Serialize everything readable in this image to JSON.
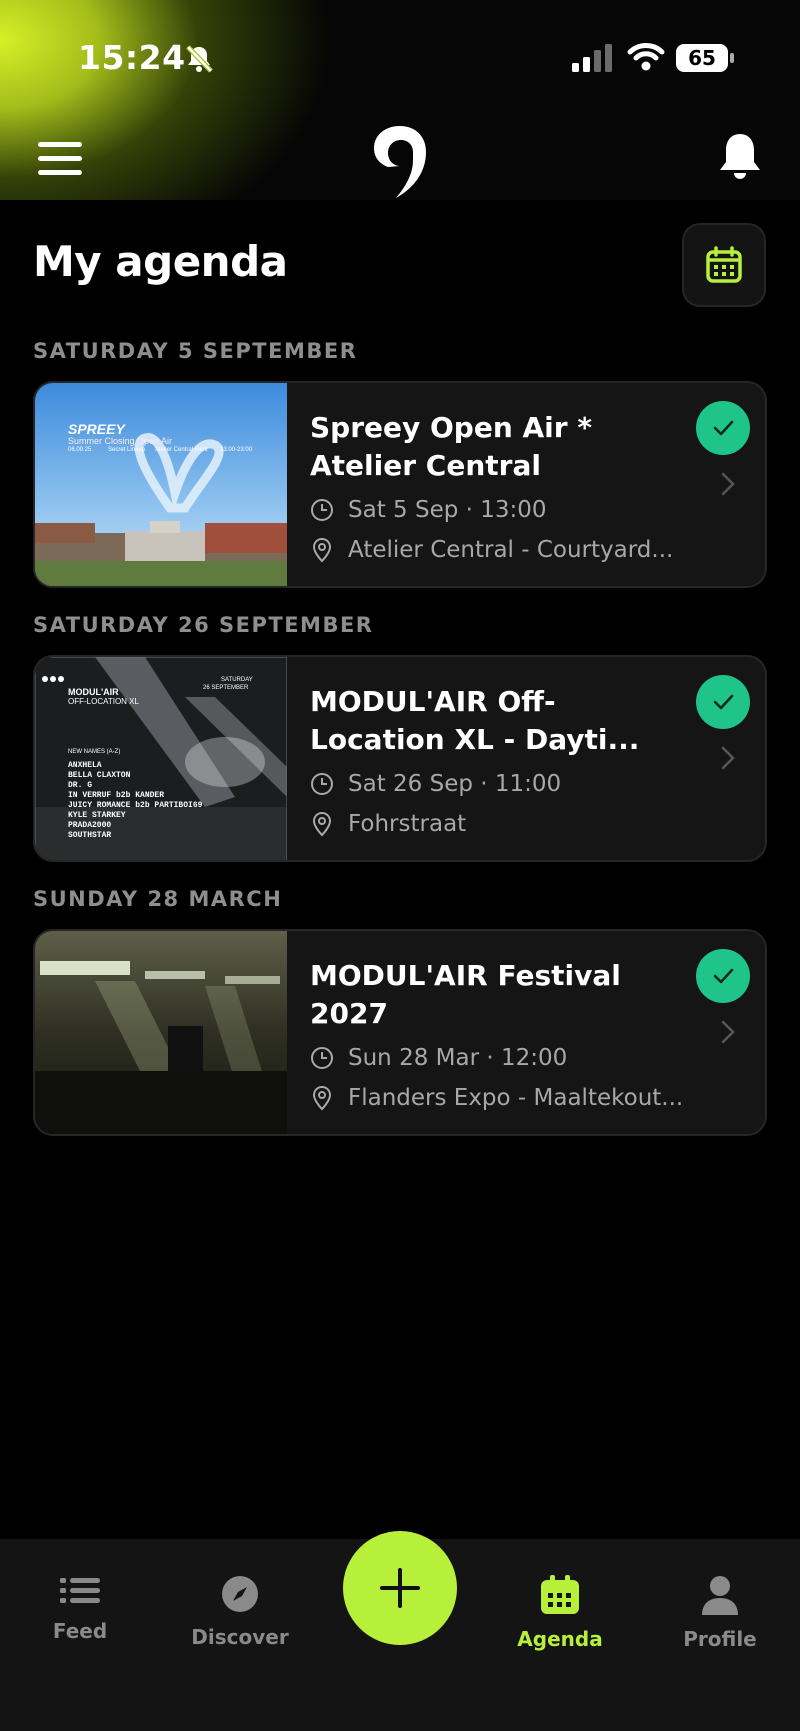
{
  "status": {
    "time": "15:24",
    "battery": "65"
  },
  "header": {
    "page_title": "My agenda"
  },
  "agenda": [
    {
      "date_label": "SATURDAY 5 SEPTEMBER",
      "title_line1": "Spreey Open Air *",
      "title_line2": "Atelier Central",
      "datetime": "Sat 5 Sep · 13:00",
      "location": "Atelier Central - Courtyard..."
    },
    {
      "date_label": "SATURDAY 26 SEPTEMBER",
      "title_line1": "MODUL'AIR Off-",
      "title_line2": "Location XL - Dayti...",
      "datetime": "Sat 26 Sep · 11:00",
      "location": "Fohrstraat"
    },
    {
      "date_label": "SUNDAY 28 MARCH",
      "title_line1": "MODUL'AIR Festival",
      "title_line2": "2027",
      "datetime": "Sun 28 Mar · 12:00",
      "location": "Flanders Expo - Maaltekout..."
    }
  ],
  "poster1": {
    "brand": "SPREEY",
    "sub": "Summer Closing Open Air",
    "date": "06.09.25",
    "line": "Secret Lineup",
    "venue": "Atelier Central Gent",
    "hours": "13:00-23:00"
  },
  "poster2": {
    "brand": "MODUL'AIR",
    "sub": "OFF-LOCATION XL",
    "day": "SATURDAY",
    "date": "26 SEPTEMBER",
    "heading": "NEW NAMES (A-Z)",
    "names": [
      "ANXHELA",
      "BELLA CLAXTON",
      "DR. G",
      "IN VERRUF b2b KANDER",
      "JUICY ROMANCE b2b PARTIBOI69",
      "KYLE STARKEY",
      "PRADA2000",
      "SOUTHSTAR"
    ]
  },
  "tabs": {
    "feed": "Feed",
    "discover": "Discover",
    "agenda": "Agenda",
    "profile": "Profile"
  },
  "colors": {
    "accent": "#b7f03a",
    "check": "#1fc48a",
    "card_bg": "#151515",
    "muted": "#8e8e8e"
  }
}
